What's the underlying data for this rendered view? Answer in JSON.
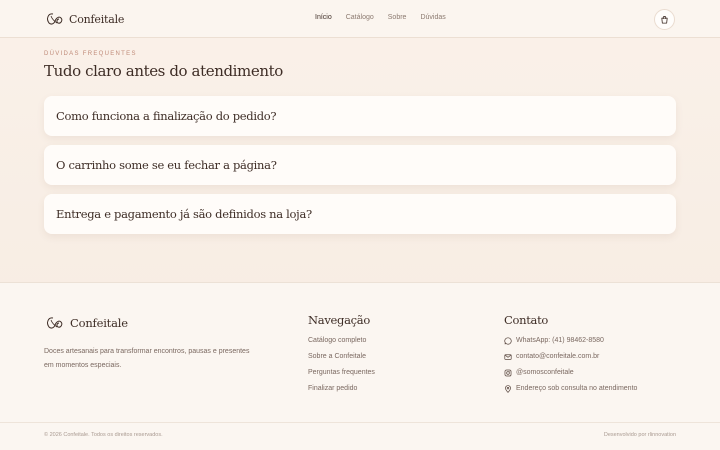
{
  "brand": {
    "name": "Confeitale"
  },
  "nav": {
    "items": [
      "Início",
      "Catálogo",
      "Sobre",
      "Dúvidas"
    ],
    "active_index": 0
  },
  "faq": {
    "eyebrow": "DÚVIDAS FREQUENTES",
    "title": "Tudo claro antes do atendimento",
    "items": [
      "Como funciona a finalização do pedido?",
      "O carrinho some se eu fechar a página?",
      "Entrega e pagamento já são definidos na loja?"
    ]
  },
  "footer": {
    "description": "Doces artesanais para transformar encontros, pausas e presentes em momentos especiais.",
    "navigation": {
      "title": "Navegação",
      "links": [
        "Catálogo completo",
        "Sobre a Confeitale",
        "Perguntas frequentes",
        "Finalizar pedido"
      ]
    },
    "contact": {
      "title": "Contato",
      "items": [
        {
          "icon": "whatsapp-icon",
          "text": "WhatsApp: (41) 98462-8580"
        },
        {
          "icon": "mail-icon",
          "text": "contato@confeitale.com.br"
        },
        {
          "icon": "instagram-icon",
          "text": "@somosconfeitale"
        },
        {
          "icon": "location-pin-icon",
          "text": "Endereço sob consulta no atendimento"
        }
      ]
    },
    "copyright": "© 2026 Confeitale. Todos os direitos reservados.",
    "developed_by": "Desenvolvido por rlinnovation"
  },
  "colors": {
    "background": "#faf1e9",
    "text": "#3e2d26",
    "accent": "#c08a78",
    "muted": "#7a6860"
  }
}
